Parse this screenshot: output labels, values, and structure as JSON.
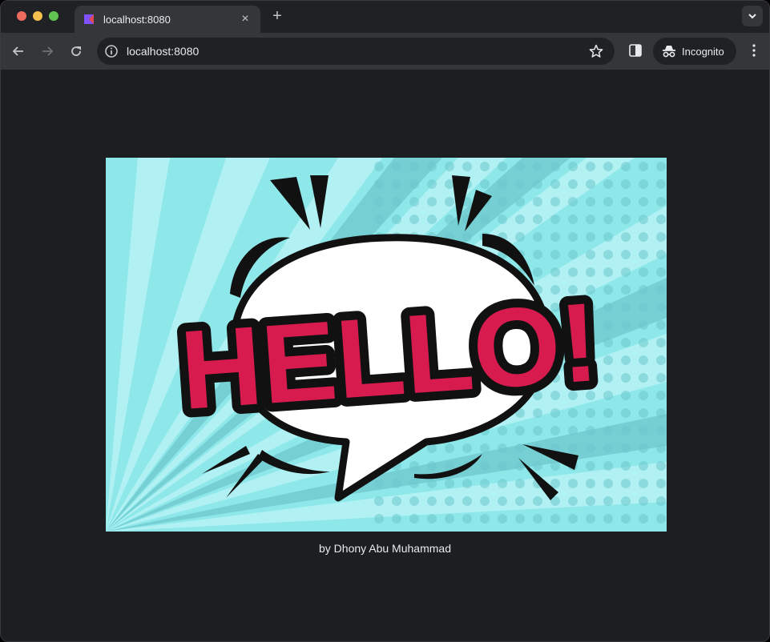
{
  "tab": {
    "title": "localhost:8080",
    "close_label": "×"
  },
  "newtab_label": "+",
  "omnibox": {
    "url": "localhost:8080"
  },
  "profile": {
    "label": "Incognito"
  },
  "content": {
    "hero_text": "HELLO!",
    "caption": "by Dhony Abu Muhammad"
  },
  "colors": {
    "hero_background": "#8ee8ea",
    "hello_red": "#d81b4f",
    "bubble_white": "#ffffff"
  }
}
